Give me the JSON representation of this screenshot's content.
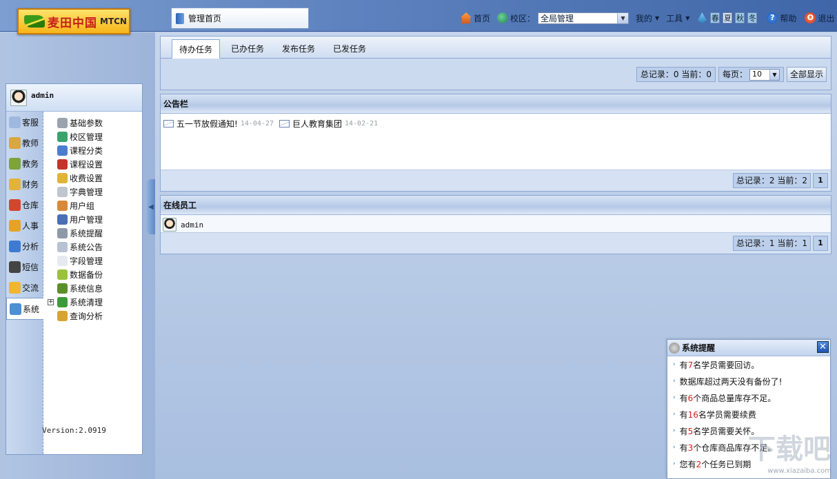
{
  "logo": {
    "text_cn": "麦田中国",
    "text_en": "MTCN"
  },
  "home_tab": {
    "label": "管理首页"
  },
  "topnav": {
    "home": "首页",
    "campus_label": "校区：",
    "campus_value": "全局管理",
    "mine": "我的",
    "tools": "工具",
    "skins": [
      "春",
      "夏",
      "秋",
      "冬"
    ],
    "help": "帮助",
    "logout": "退出"
  },
  "sidebar": {
    "user": "admin",
    "categories": [
      {
        "label": "客服",
        "icon": "customer-service-icon",
        "color": "#9fb8e0"
      },
      {
        "label": "教师",
        "icon": "teacher-icon",
        "color": "#d9a640"
      },
      {
        "label": "教务",
        "icon": "academic-icon",
        "color": "#7da33b"
      },
      {
        "label": "财务",
        "icon": "finance-icon",
        "color": "#e2b33a"
      },
      {
        "label": "仓库",
        "icon": "warehouse-icon",
        "color": "#d5452d"
      },
      {
        "label": "人事",
        "icon": "personnel-icon",
        "color": "#e6a227"
      },
      {
        "label": "分析",
        "icon": "analysis-icon",
        "color": "#3e7ad2"
      },
      {
        "label": "短信",
        "icon": "sms-icon",
        "color": "#444444"
      },
      {
        "label": "交流",
        "icon": "chat-icon",
        "color": "#f0b630"
      },
      {
        "label": "系统",
        "icon": "system-icon",
        "color": "#4b8fd6"
      }
    ],
    "submenu": [
      {
        "label": "基础参数",
        "icon": "gear-icon",
        "color": "#9aa3ad"
      },
      {
        "label": "校区管理",
        "icon": "globe-icon",
        "color": "#3aa36b"
      },
      {
        "label": "课程分类",
        "icon": "book-stack-icon",
        "color": "#4a7dd0"
      },
      {
        "label": "课程设置",
        "icon": "book-icon",
        "color": "#c2332b"
      },
      {
        "label": "收费设置",
        "icon": "coins-icon",
        "color": "#e0b436"
      },
      {
        "label": "字典管理",
        "icon": "dictionary-icon",
        "color": "#bfc6cf"
      },
      {
        "label": "用户组",
        "icon": "users-icon",
        "color": "#d88a3a"
      },
      {
        "label": "用户管理",
        "icon": "user-icon",
        "color": "#4a6fb6"
      },
      {
        "label": "系统提醒",
        "icon": "speaker-icon",
        "color": "#8f9aa8"
      },
      {
        "label": "系统公告",
        "icon": "notice-icon",
        "color": "#b7c2d2"
      },
      {
        "label": "字段管理",
        "icon": "field-icon",
        "color": "#e6eaf0"
      },
      {
        "label": "数据备份",
        "icon": "backup-icon",
        "color": "#9bc23a"
      },
      {
        "label": "系统信息",
        "icon": "info-icon",
        "color": "#5a8f2a"
      },
      {
        "label": "系统清理",
        "icon": "recycle-icon",
        "color": "#3c9a3a"
      },
      {
        "label": "查询分析",
        "icon": "magnifier-icon",
        "color": "#d8a335"
      }
    ],
    "version": "Version:2.0919"
  },
  "tasks": {
    "tabs": [
      "待办任务",
      "已办任务",
      "发布任务",
      "已发任务"
    ],
    "active_tab": 0,
    "summary": "总记录：0 当前：0",
    "per_page_label": "每页：",
    "per_page_value": "10",
    "show_all": "全部显示"
  },
  "notice": {
    "title": "公告栏",
    "items": [
      {
        "title": "五一节放假通知!",
        "date": "14-04-27"
      },
      {
        "title": "巨人教育集团",
        "date": "14-02-21"
      }
    ],
    "summary": "总记录：2 当前：2",
    "page": "1"
  },
  "online": {
    "title": "在线员工",
    "users": [
      "admin"
    ],
    "summary": "总记录：1 当前：1",
    "page": "1"
  },
  "reminder": {
    "title": "系统提醒",
    "items": [
      {
        "pre": "有",
        "num": "7",
        "post": "名学员需要回访。"
      },
      {
        "pre": "数据库超过两天没有备份了!",
        "num": "",
        "post": ""
      },
      {
        "pre": "有",
        "num": "6",
        "post": "个商品总量库存不足。"
      },
      {
        "pre": "有",
        "num": "16",
        "post": "名学员需要续费"
      },
      {
        "pre": "有",
        "num": "5",
        "post": "名学员需要关怀。"
      },
      {
        "pre": "有",
        "num": "3",
        "post": "个仓库商品库存不足。"
      },
      {
        "pre": "您有",
        "num": "2",
        "post": "个任务已到期"
      }
    ]
  },
  "watermark": {
    "text": "下载吧",
    "site": "www.xiazaiba.com"
  }
}
